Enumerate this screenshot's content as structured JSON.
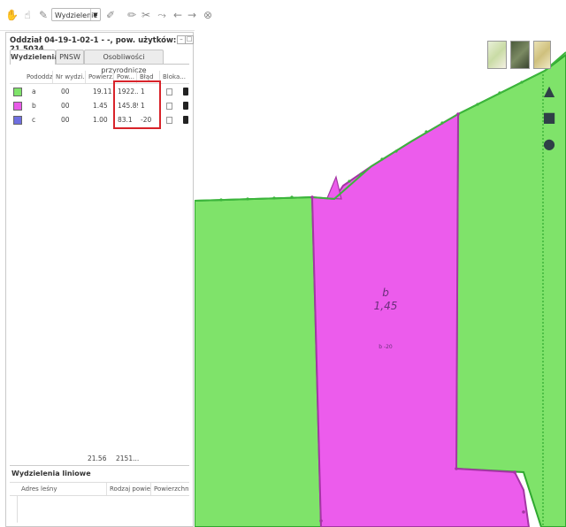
{
  "toolbar": {
    "mode_select": "Wydzielenie",
    "icons": [
      "hand-icon",
      "pointer-icon",
      "brush-icon",
      "edit-icon",
      "pencil-icon",
      "cut-icon",
      "merge-icon",
      "arrow-left-icon",
      "arrow-right-icon",
      "close-circle-icon"
    ]
  },
  "panel": {
    "title": "Oddział 04-19-1-02-1 - -, pow. użytków: 21.5034",
    "tabs": [
      "Wydzielenia",
      "PNSW",
      "Osobliwości przyrodnicze"
    ],
    "active_tab": "Wydzielenia",
    "columns": [
      "Pododdział",
      "Nr wydzi...",
      "Powierz...",
      "Pow...",
      "Błąd",
      "Bloka..."
    ],
    "rows": [
      {
        "color": "#7fe36a",
        "pododdzial": "a",
        "nr": "00",
        "powierzchnia": "19.11",
        "pow": "1922...",
        "blad": "1"
      },
      {
        "color": "#e85be8",
        "pododdzial": "b",
        "nr": "00",
        "powierzchnia": "1.45",
        "pow": "145.89",
        "blad": "1"
      },
      {
        "color": "#6f6fe0",
        "pododdzial": "c",
        "nr": "00",
        "powierzchnia": "1.00",
        "pow": "83.1",
        "blad": "-20"
      }
    ],
    "totals": {
      "powierzchnia": "21.56",
      "pow": "2151..."
    },
    "linear": {
      "title": "Wydzielenia liniowe",
      "columns": [
        "Adres leśny",
        "Rodzaj powierzc...",
        "Powierzchnia"
      ]
    }
  },
  "map": {
    "label_name": "b",
    "label_area": "1,45",
    "label_error": "b -20",
    "colors": {
      "green": "#7fe36a",
      "magenta": "#ec5cec",
      "edge": "#2fa82f",
      "magenta_edge": "#a436a4"
    }
  }
}
